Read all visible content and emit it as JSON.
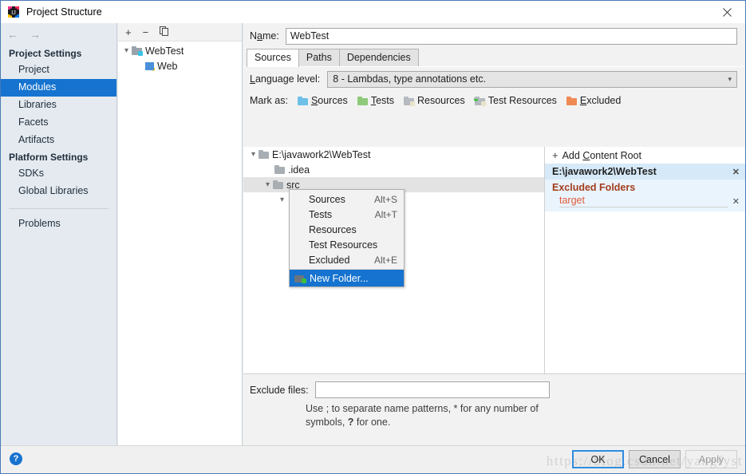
{
  "window": {
    "title": "Project Structure",
    "title_icon": "intellij-idea-icon",
    "close_icon": "close-icon"
  },
  "sidebar": {
    "back_icon": "arrow-left-icon",
    "forward_icon": "arrow-right-icon",
    "groups": [
      {
        "label": "Project Settings",
        "items": [
          {
            "label": "Project",
            "selected": false
          },
          {
            "label": "Modules",
            "selected": true
          },
          {
            "label": "Libraries",
            "selected": false
          },
          {
            "label": "Facets",
            "selected": false
          },
          {
            "label": "Artifacts",
            "selected": false
          }
        ]
      },
      {
        "label": "Platform Settings",
        "items": [
          {
            "label": "SDKs",
            "selected": false
          },
          {
            "label": "Global Libraries",
            "selected": false
          }
        ]
      }
    ],
    "problems_label": "Problems"
  },
  "modules_panel": {
    "toolbar": {
      "add_label": "+",
      "remove_label": "−",
      "copy_label": "❐"
    },
    "tree": [
      {
        "label": "WebTest",
        "icon": "module-folder-icon",
        "expander": "⌄",
        "indent": 0
      },
      {
        "label": "Web",
        "icon": "web-facet-icon",
        "expander": "",
        "indent": 1
      }
    ]
  },
  "main": {
    "name_label": "Name:",
    "name_value": "WebTest",
    "tabs": [
      {
        "label": "Sources",
        "active": true
      },
      {
        "label": "Paths",
        "active": false
      },
      {
        "label": "Dependencies",
        "active": false
      }
    ],
    "language_level_label": "Language level:",
    "language_level_value": "8 - Lambdas, type annotations etc.",
    "language_level_chevron": "chevron-down-icon",
    "mark_as_label": "Mark as:",
    "mark_as_items": [
      {
        "label": "Sources",
        "color": "#6ec0e8",
        "icon": "folder-sources-icon"
      },
      {
        "label": "Tests",
        "color": "#8fc97a",
        "icon": "folder-tests-icon"
      },
      {
        "label": "Resources",
        "color": "#b4bac0",
        "icon": "folder-resources-icon"
      },
      {
        "label": "Test Resources",
        "color": "#b4bac0",
        "icon": "folder-test-resources-icon"
      },
      {
        "label": "Excluded",
        "color": "#ef8a54",
        "icon": "folder-excluded-icon"
      }
    ],
    "source_tree": [
      {
        "label": "E:\\javawork2\\WebTest",
        "indent": 0,
        "expander": "⌄",
        "selected": false
      },
      {
        "label": ".idea",
        "indent": 1,
        "expander": "",
        "selected": false
      },
      {
        "label": "src",
        "indent": 1,
        "expander": "⌄",
        "selected": true
      },
      {
        "label": "",
        "indent": 2,
        "expander": "⌄",
        "selected": false
      }
    ],
    "exclude_files_label": "Exclude files:",
    "exclude_files_value": "",
    "exclude_hint_part1": "Use ; to separate name patterns, * for any number of",
    "exclude_hint_part2": "symbols, ",
    "exclude_hint_bold": "?",
    "exclude_hint_part3": " for one."
  },
  "content_roots": {
    "add_label": "Add Content Root",
    "add_icon": "plus-icon",
    "root_path": "E:\\javawork2\\WebTest",
    "root_remove_icon": "close-icon",
    "excluded_title": "Excluded Folders",
    "excluded_items": [
      {
        "name": "target",
        "remove_icon": "close-icon"
      }
    ]
  },
  "context_menu": {
    "items": [
      {
        "label": "Sources",
        "shortcut": "Alt+S",
        "highlight": false
      },
      {
        "label": "Tests",
        "shortcut": "Alt+T",
        "highlight": false
      },
      {
        "label": "Resources",
        "shortcut": "",
        "highlight": false
      },
      {
        "label": "Test Resources",
        "shortcut": "",
        "highlight": false
      },
      {
        "label": "Excluded",
        "shortcut": "Alt+E",
        "highlight": false
      }
    ],
    "new_folder_label": "New Folder...",
    "new_folder_icon": "new-folder-icon"
  },
  "footer": {
    "help_label": "?",
    "ok_label": "OK",
    "cancel_label": "Cancel",
    "apply_label": "Apply"
  },
  "watermark": {
    "text": "https://blog.csdn.net/yangfyst"
  },
  "colors": {
    "accent": "#1673cf",
    "selection_blue": "#1673cf",
    "content_root_bar": "#d6e9f8",
    "excluded_title": "#a33d1e",
    "excluded_item": "#e05b3a",
    "window_border": "#4a7ab5"
  }
}
